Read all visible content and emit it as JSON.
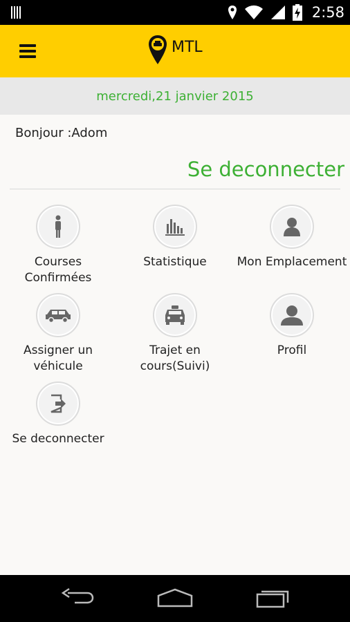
{
  "status_bar": {
    "time": "2:58",
    "icons": [
      "barcode-icon",
      "location-icon",
      "wifi-icon",
      "signal-icon",
      "battery-charging-icon"
    ]
  },
  "app_bar": {
    "menu_icon": "hamburger-icon",
    "logo_icon": "taxi-pin-icon",
    "logo_text": "MTL",
    "brand_color": "#ffce00"
  },
  "date_text": "mercredi,21 janvier 2015",
  "greeting": "Bonjour :Adom",
  "logout_link": "Se deconnecter",
  "accent_color": "#3db034",
  "menu": {
    "items": [
      {
        "label": "Courses Confirmées",
        "icon": "person-icon"
      },
      {
        "label": "Statistique",
        "icon": "bar-chart-icon"
      },
      {
        "label": "Mon Emplacement",
        "icon": "user-location-icon"
      },
      {
        "label": "Assigner un véhicule",
        "icon": "car-icon"
      },
      {
        "label": "Trajet en cours(Suivi)",
        "icon": "taxi-icon"
      },
      {
        "label": "Profil",
        "icon": "profile-icon"
      },
      {
        "label": "Se deconnecter",
        "icon": "logout-icon"
      }
    ]
  },
  "nav_bar": {
    "buttons": [
      "back-icon",
      "home-icon",
      "recents-icon"
    ]
  }
}
